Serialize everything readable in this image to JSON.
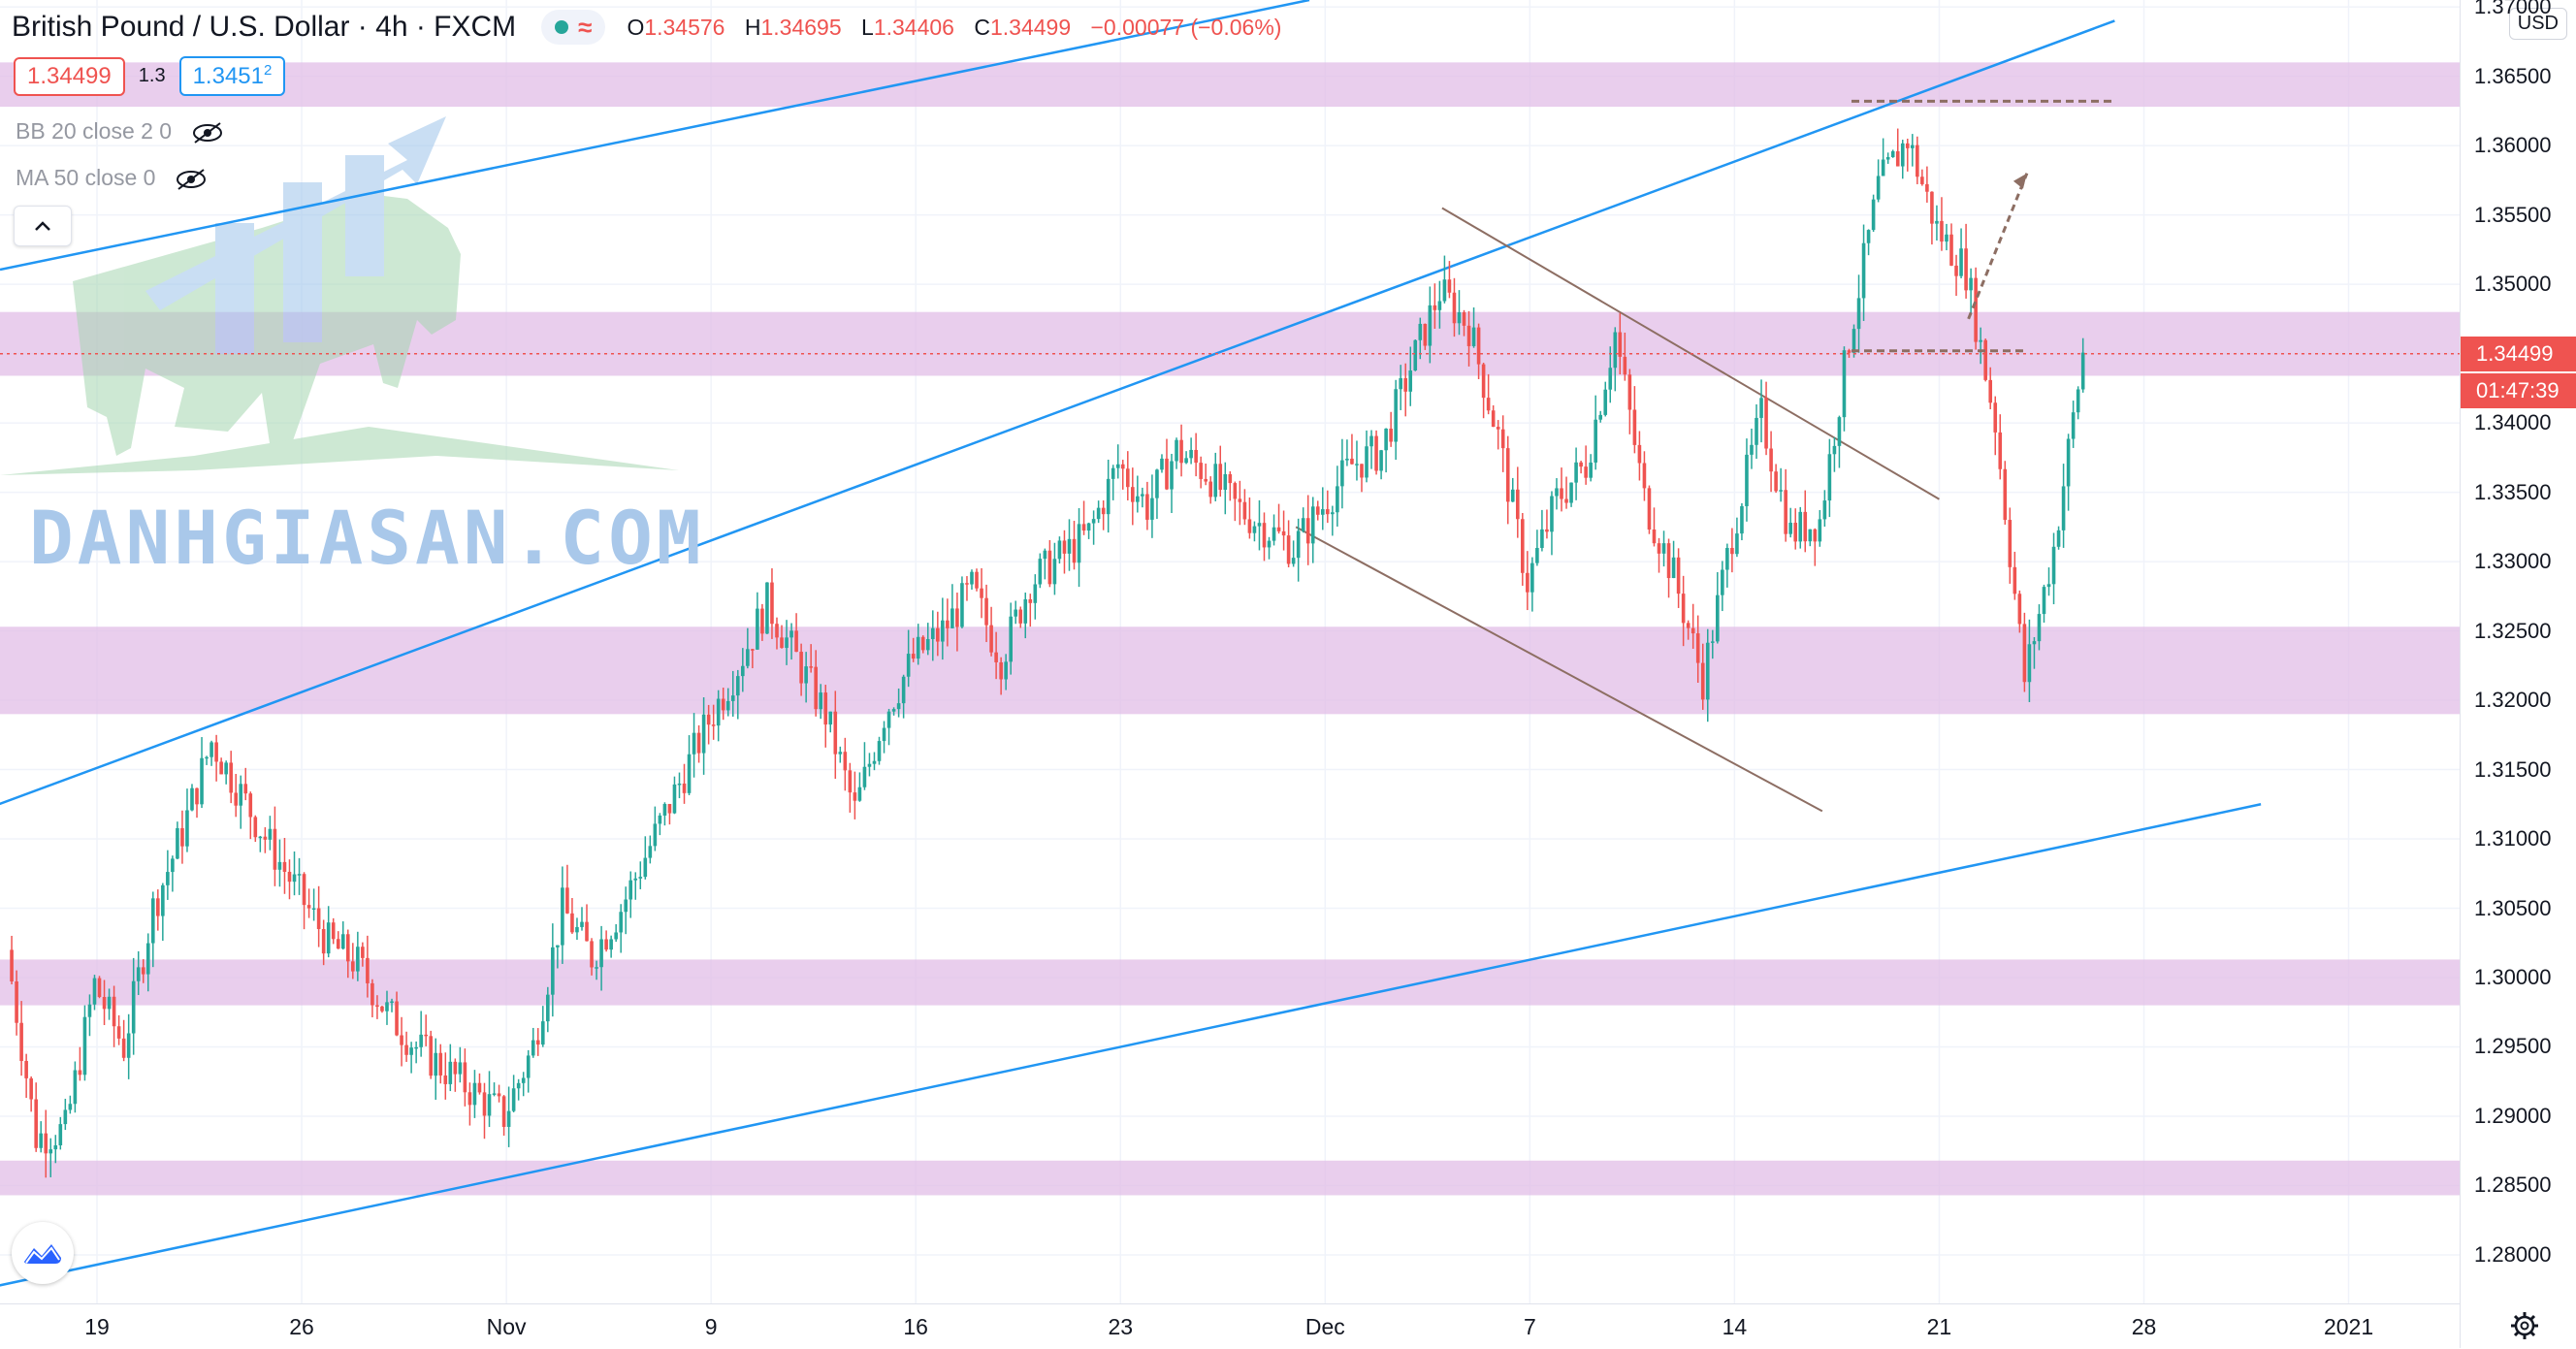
{
  "header": {
    "title": "British Pound / U.S. Dollar · 4h · FXCM",
    "ohlc": [
      {
        "label": "O",
        "value": "1.34576"
      },
      {
        "label": "H",
        "value": "1.34695"
      },
      {
        "label": "L",
        "value": "1.34406"
      },
      {
        "label": "C",
        "value": "1.34499"
      }
    ],
    "change": "−0.00077 (−0.06%)"
  },
  "quote": {
    "bid": "1.34499",
    "spread": "1.3",
    "ask": "1.3451",
    "ask_sup": "2"
  },
  "indicators": [
    {
      "label": "BB 20 close 2 0"
    },
    {
      "label": "MA 50 close 0"
    }
  ],
  "watermark": "DANHGIASAN.COM",
  "right_scale": {
    "currency": "USD",
    "last_price": "1.34499",
    "countdown": "01:47:39",
    "ticks": [
      "1.37000",
      "1.36500",
      "1.36000",
      "1.35500",
      "1.35000",
      "1.34500",
      "1.34000",
      "1.33500",
      "1.33000",
      "1.32500",
      "1.32000",
      "1.31500",
      "1.31000",
      "1.30500",
      "1.30000",
      "1.29500",
      "1.29000",
      "1.28500",
      "1.28000"
    ]
  },
  "colors": {
    "up": "#26a69a",
    "down": "#ef5350",
    "zone": "#e1bee7",
    "trend": "#2196f3",
    "channel": "#8d6e63"
  },
  "chart_data": {
    "type": "candlestick",
    "title": "British Pound / U.S. Dollar · 4h · FXCM",
    "xlabel": "",
    "ylabel": "",
    "x_ticks": [
      "19",
      "26",
      "Nov",
      "9",
      "16",
      "23",
      "Dec",
      "7",
      "14",
      "21",
      "28",
      "2021"
    ],
    "ylim": [
      1.2765,
      1.3705
    ],
    "grid": true,
    "price_path": [
      [
        "Oct 16",
        1.302
      ],
      [
        "Oct 17",
        1.2885
      ],
      [
        "Oct 18",
        1.289
      ],
      [
        "Oct 19",
        1.2995
      ],
      [
        "Oct 20",
        1.295
      ],
      [
        "Oct 21",
        1.305
      ],
      [
        "Oct 22",
        1.3105
      ],
      [
        "Oct 23",
        1.317
      ],
      [
        "Oct 25",
        1.3095
      ],
      [
        "Oct 27",
        1.3025
      ],
      [
        "Oct 28",
        1.301
      ],
      [
        "Oct 29",
        1.2975
      ],
      [
        "Oct 30",
        1.295
      ],
      [
        "Nov 2",
        1.29
      ],
      [
        "Nov 3",
        1.295
      ],
      [
        "Nov 4",
        1.305
      ],
      [
        "Nov 5",
        1.3015
      ],
      [
        "Nov 6",
        1.305
      ],
      [
        "Nov 8",
        1.314
      ],
      [
        "Nov 9",
        1.3185
      ],
      [
        "Nov 10",
        1.3225
      ],
      [
        "Nov 11",
        1.327
      ],
      [
        "Nov 12",
        1.323
      ],
      [
        "Nov 13",
        1.319
      ],
      [
        "Nov 14",
        1.312
      ],
      [
        "Nov 15",
        1.319
      ],
      [
        "Nov 16",
        1.323
      ],
      [
        "Nov 17",
        1.325
      ],
      [
        "Nov 18",
        1.328
      ],
      [
        "Nov 19",
        1.323
      ],
      [
        "Nov 20",
        1.3285
      ],
      [
        "Nov 22",
        1.332
      ],
      [
        "Nov 23",
        1.337
      ],
      [
        "Nov 24",
        1.334
      ],
      [
        "Nov 25",
        1.338
      ],
      [
        "Nov 26",
        1.3365
      ],
      [
        "Nov 27",
        1.334
      ],
      [
        "Nov 29",
        1.331
      ],
      [
        "Nov 30",
        1.334
      ],
      [
        "Dec 1",
        1.337
      ],
      [
        "Dec 2",
        1.338
      ],
      [
        "Dec 3",
        1.344
      ],
      [
        "Dec 4",
        1.3495
      ],
      [
        "Dec 5",
        1.347
      ],
      [
        "Dec 6",
        1.339
      ],
      [
        "Dec 7",
        1.3285
      ],
      [
        "Dec 8",
        1.3345
      ],
      [
        "Dec 9",
        1.337
      ],
      [
        "Dec 10",
        1.3465
      ],
      [
        "Dec 11",
        1.3345
      ],
      [
        "Dec 12",
        1.329
      ],
      [
        "Dec 13",
        1.3215
      ],
      [
        "Dec 14",
        1.332
      ],
      [
        "Dec 15",
        1.3405
      ],
      [
        "Dec 16",
        1.332
      ],
      [
        "Dec 17",
        1.333
      ],
      [
        "Dec 18",
        1.346
      ],
      [
        "Dec 19",
        1.357
      ],
      [
        "Dec 20",
        1.3605
      ],
      [
        "Dec 21",
        1.354
      ],
      [
        "Dec 22",
        1.351
      ],
      [
        "Dec 23",
        1.34
      ],
      [
        "Dec 24",
        1.3215
      ],
      [
        "Dec 25",
        1.331
      ],
      [
        "Dec 26",
        1.345
      ]
    ],
    "support_resistance_zones": [
      [
        1.3628,
        1.366
      ],
      [
        1.3434,
        1.348
      ],
      [
        1.319,
        1.3253
      ],
      [
        1.298,
        1.3013
      ],
      [
        1.2843,
        1.2868
      ]
    ],
    "ascending_channel": {
      "upper_line": [
        [
          "Oct 15",
          1.312
        ],
        [
          "Dec 27",
          1.369
        ]
      ],
      "lower_line": [
        [
          "Oct 15",
          1.2775
        ],
        [
          "Jan 1",
          1.3125
        ]
      ]
    },
    "descending_channel": {
      "upper_line": [
        [
          "Dec 4",
          1.3555
        ],
        [
          "Dec 21",
          1.3345
        ]
      ],
      "lower_line": [
        [
          "Nov 29",
          1.3325
        ],
        [
          "Dec 17",
          1.312
        ]
      ]
    },
    "horizontal_levels": [
      1.3632,
      1.3452
    ],
    "last_price": 1.34499
  }
}
